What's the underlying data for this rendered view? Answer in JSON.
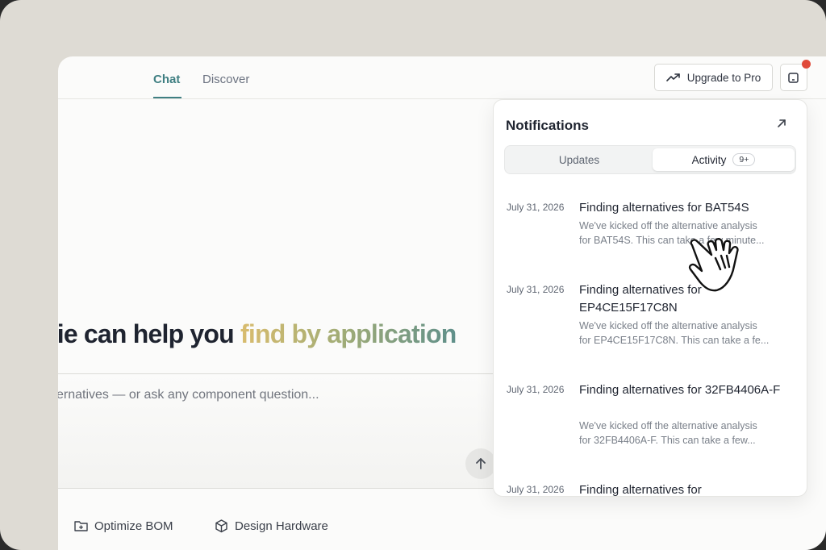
{
  "header": {
    "tabs": [
      {
        "label": "Chat",
        "active": true
      },
      {
        "label": "Discover",
        "active": false
      }
    ],
    "upgrade_label": "Upgrade to Pro",
    "notification_dot": true
  },
  "main": {
    "hero_text": "nie can help you ",
    "hero_accent": "find by application",
    "input_placeholder": "lternatives — or ask any component question...",
    "quick_actions": [
      {
        "label": "Optimize BOM",
        "icon": "folder-plus-icon"
      },
      {
        "label": "Design Hardware",
        "icon": "cube-icon"
      }
    ]
  },
  "notifications": {
    "title": "Notifications",
    "tabs": {
      "updates": "Updates",
      "activity": "Activity",
      "activity_badge": "9+"
    },
    "items": [
      {
        "date": "July 31, 2026",
        "title": "Finding alternatives for BAT54S",
        "desc_line1": "We've kicked off the alternative analysis",
        "desc_line2": "for BAT54S. This can take a few minute..."
      },
      {
        "date": "July 31, 2026",
        "title": "Finding alternatives for EP4CE15F17C8N",
        "desc_line1": "We've kicked off the alternative analysis",
        "desc_line2": "for EP4CE15F17C8N. This can take a fe..."
      },
      {
        "date": "July 31, 2026",
        "title": "Finding alternatives for 32FB4406A-F",
        "desc_line1": "We've kicked off the alternative analysis",
        "desc_line2": "for 32FB4406A-F. This can take a few..."
      },
      {
        "date": "July 31, 2026",
        "title": "Finding alternatives for",
        "desc_line1": "",
        "desc_line2": ""
      }
    ]
  },
  "colors": {
    "accent": "#3f7f82",
    "notification_dot": "#e04a3a",
    "backdrop": "#dedbd4"
  }
}
